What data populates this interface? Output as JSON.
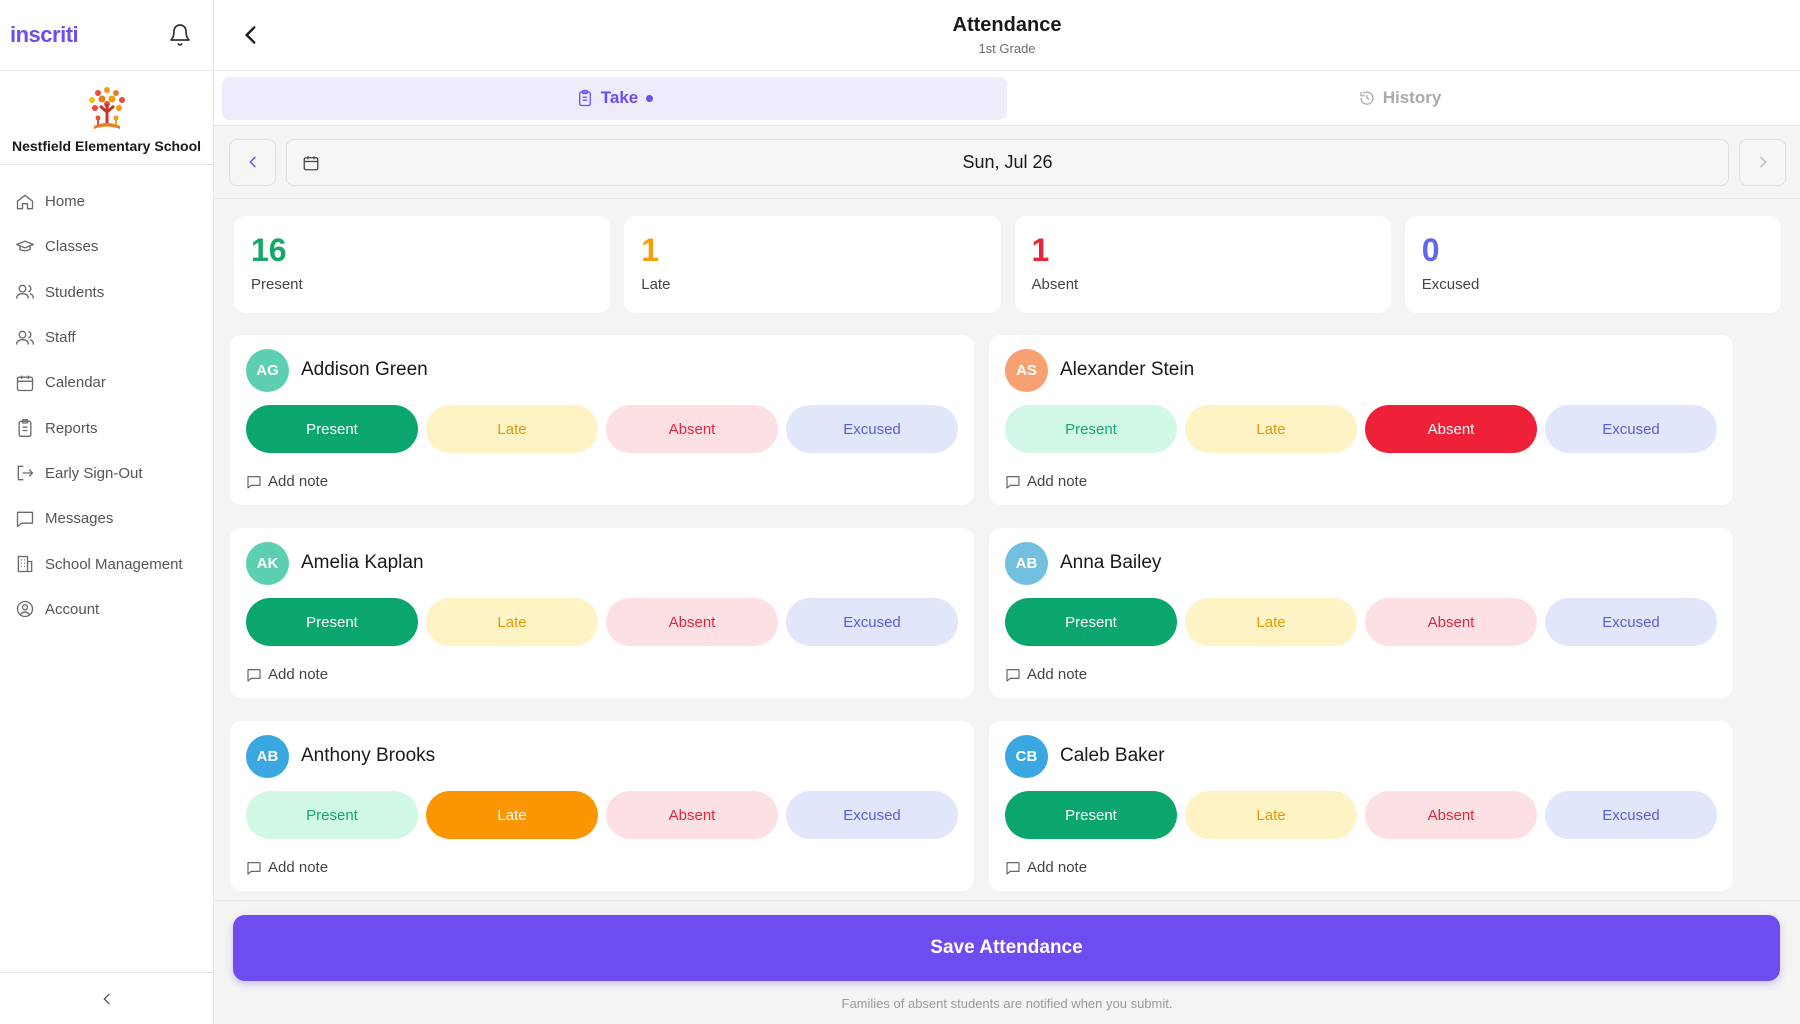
{
  "app": {
    "logo_text": "inscriti",
    "brand_color": "#6d4cf0"
  },
  "school": {
    "name": "Nestfield Elementary School"
  },
  "sidebar": {
    "items": [
      {
        "label": "Home",
        "icon": "home-icon"
      },
      {
        "label": "Classes",
        "icon": "graduation-cap-icon"
      },
      {
        "label": "Students",
        "icon": "users-icon"
      },
      {
        "label": "Staff",
        "icon": "users-icon"
      },
      {
        "label": "Calendar",
        "icon": "calendar-icon"
      },
      {
        "label": "Reports",
        "icon": "clipboard-icon"
      },
      {
        "label": "Early Sign-Out",
        "icon": "sign-out-icon"
      },
      {
        "label": "Messages",
        "icon": "message-icon"
      },
      {
        "label": "School Management",
        "icon": "building-icon"
      },
      {
        "label": "Account",
        "icon": "account-icon"
      }
    ]
  },
  "header": {
    "title": "Attendance",
    "subtitle": "1st Grade"
  },
  "tabs": [
    {
      "label": "Take",
      "icon": "clipboard-icon",
      "active": true
    },
    {
      "label": "History",
      "icon": "history-icon",
      "active": false
    }
  ],
  "date": {
    "label": "Sun, Jul 26"
  },
  "stats": [
    {
      "value": "16",
      "label": "Present",
      "color": "#14a86b"
    },
    {
      "value": "1",
      "label": "Late",
      "color": "#f59e0b"
    },
    {
      "value": "1",
      "label": "Absent",
      "color": "#e8273b"
    },
    {
      "value": "0",
      "label": "Excused",
      "color": "#6366f1"
    }
  ],
  "status_options": [
    "Present",
    "Late",
    "Absent",
    "Excused"
  ],
  "note_label": "Add note",
  "students": [
    {
      "initials": "AG",
      "name": "Addison Green",
      "avatar_color": "#5ccfb0",
      "status": "Present"
    },
    {
      "initials": "AS",
      "name": "Alexander Stein",
      "avatar_color": "#f7a072",
      "status": "Absent"
    },
    {
      "initials": "AK",
      "name": "Amelia Kaplan",
      "avatar_color": "#5ccfb0",
      "status": "Present"
    },
    {
      "initials": "AB",
      "name": "Anna Bailey",
      "avatar_color": "#72bfe0",
      "status": "Present"
    },
    {
      "initials": "AB",
      "name": "Anthony Brooks",
      "avatar_color": "#3aa7e0",
      "status": "Late"
    },
    {
      "initials": "CB",
      "name": "Caleb Baker",
      "avatar_color": "#3aa7e0",
      "status": "Present"
    }
  ],
  "save": {
    "label": "Save Attendance",
    "footnote": "Families of absent students are notified when you submit."
  }
}
